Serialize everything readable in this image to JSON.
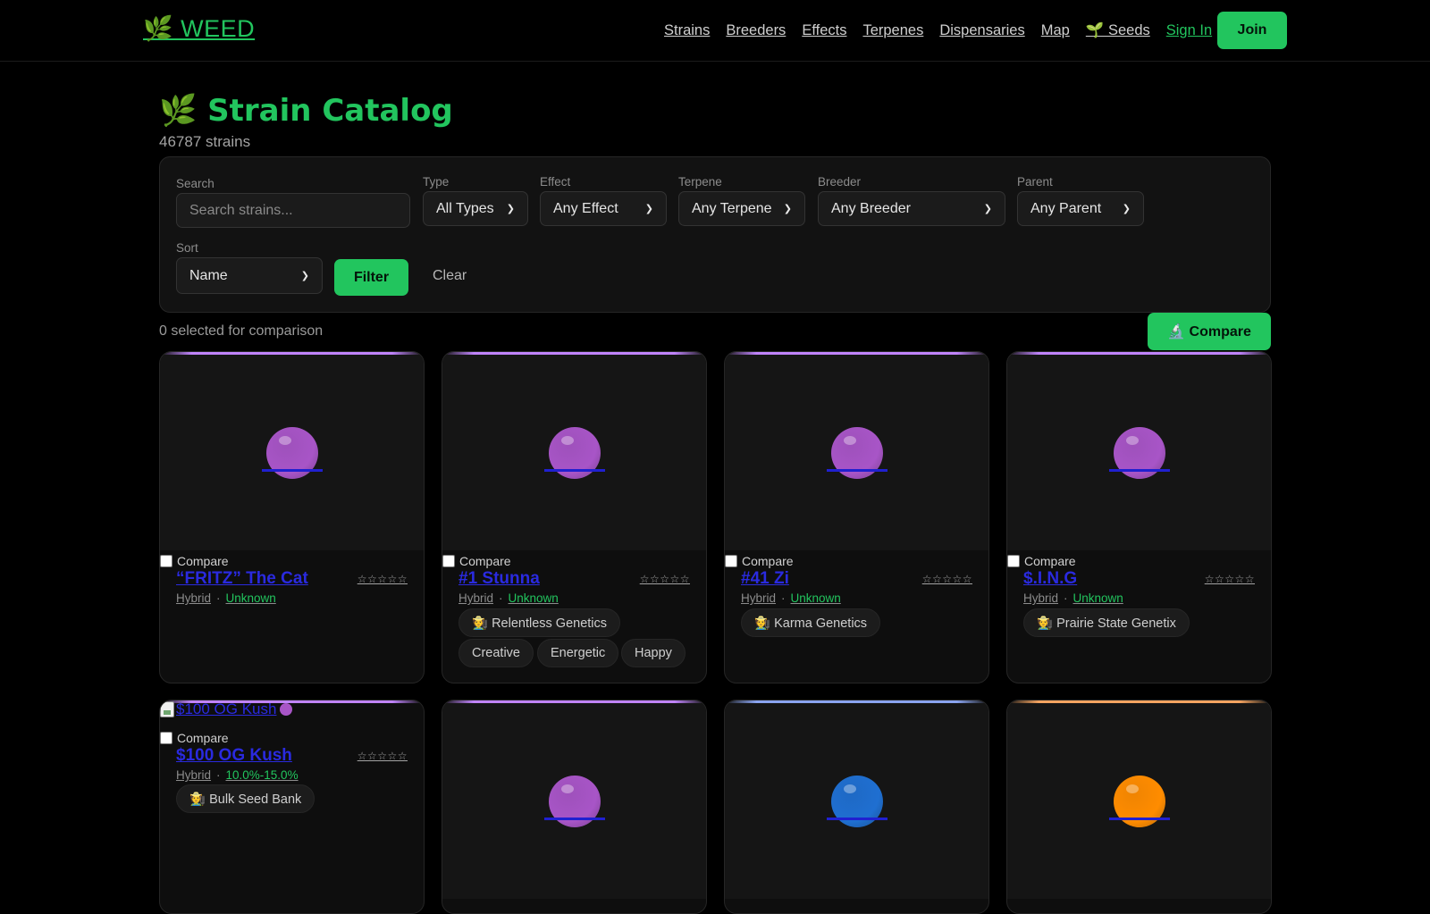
{
  "header": {
    "logo_text": "🌿 WEED",
    "nav": [
      "Strains",
      "Breeders",
      "Effects",
      "Terpenes",
      "Dispensaries",
      "Map",
      "🌱 Seeds",
      "Sign In"
    ],
    "join_label": "Join"
  },
  "page": {
    "title": "🌿 Strain Catalog",
    "count": "46787 strains"
  },
  "filters": {
    "search_label": "Search",
    "search_placeholder": "Search strains...",
    "type_label": "Type",
    "type_value": "All Types",
    "effect_label": "Effect",
    "effect_value": "Any Effect",
    "terpene_label": "Terpene",
    "terpene_value": "Any Terpene",
    "breeder_label": "Breeder",
    "breeder_value": "Any Breeder",
    "parent_label": "Parent",
    "parent_value": "Any Parent",
    "sort_label": "Sort",
    "sort_value": "Name",
    "filter_button": "Filter",
    "clear_button": "Clear"
  },
  "comparison": {
    "selected_text": "0 selected for comparison",
    "compare_button": "🔬 Compare"
  },
  "cards": [
    {
      "name": "“FRITZ” The Cat",
      "type": "Hybrid",
      "thc": "Unknown",
      "stars": "☆☆☆☆☆",
      "compare_label": "Compare",
      "breeder": "",
      "effects": [],
      "orb_color": "#a855c7",
      "accent": "#c084fc"
    },
    {
      "name": "#1 Stunna",
      "type": "Hybrid",
      "thc": "Unknown",
      "stars": "☆☆☆☆☆",
      "compare_label": "Compare",
      "breeder": "🧑‍🌾 Relentless Genetics",
      "effects": [
        "Creative",
        "Energetic",
        "Happy"
      ],
      "orb_color": "#a855c7",
      "accent": "#c084fc"
    },
    {
      "name": "#41 Zi",
      "type": "Hybrid",
      "thc": "Unknown",
      "stars": "☆☆☆☆☆",
      "compare_label": "Compare",
      "breeder": "🧑‍🌾 Karma Genetics",
      "effects": [],
      "orb_color": "#a855c7",
      "accent": "#c084fc"
    },
    {
      "name": "$.I.N.G",
      "type": "Hybrid",
      "thc": "Unknown",
      "stars": "☆☆☆☆☆",
      "compare_label": "Compare",
      "breeder": "🧑‍🌾 Prairie State Genetix",
      "effects": [],
      "orb_color": "#a855c7",
      "accent": "#c084fc"
    },
    {
      "name": "$100 OG Kush",
      "type": "Hybrid",
      "thc": "10.0%-15.0%",
      "stars": "☆☆☆☆☆",
      "compare_label": "Compare",
      "breeder": "🧑‍🌾 Bulk Seed Bank",
      "effects": [],
      "broken_image_alt": "$100 OG Kush",
      "orb_color": "#a855c7",
      "accent": "#c084fc"
    },
    {
      "orb_color": "#a855c7",
      "accent": "#c084fc"
    },
    {
      "orb_color": "#1f6fd1",
      "accent": "#8aa4f0"
    },
    {
      "orb_color": "#ff8c00",
      "accent": "#f5a460"
    }
  ]
}
